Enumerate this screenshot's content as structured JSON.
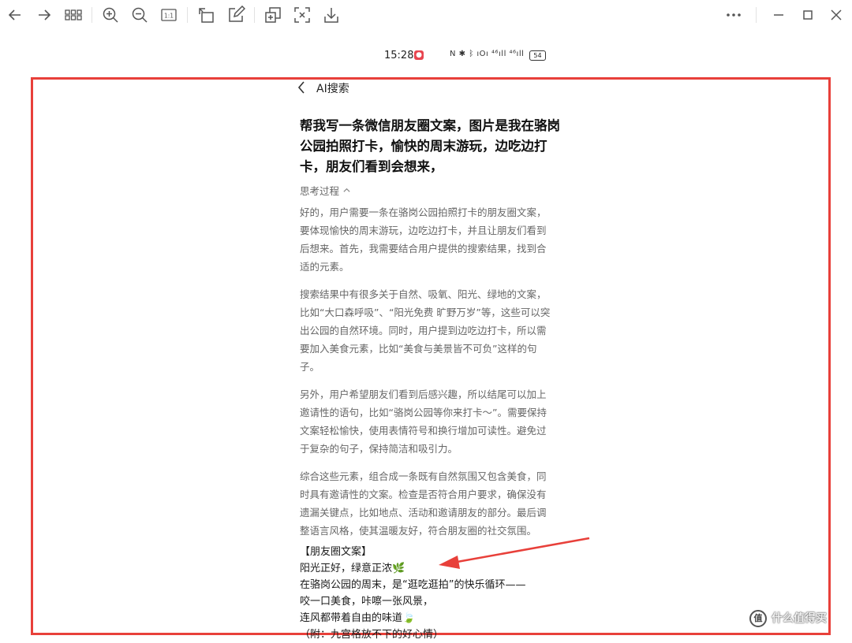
{
  "toolbar": {
    "buttons": [
      {
        "icon": "back-arrow-icon"
      },
      {
        "icon": "forward-arrow-icon"
      },
      {
        "icon": "grid-view-icon"
      },
      {
        "icon": "zoom-in-icon"
      },
      {
        "icon": "zoom-out-icon"
      },
      {
        "icon": "actual-size-icon",
        "label": "1:1"
      },
      {
        "icon": "rotate-icon"
      },
      {
        "icon": "edit-icon"
      },
      {
        "icon": "copy-icon"
      },
      {
        "icon": "screen-capture-icon"
      },
      {
        "icon": "download-icon"
      },
      {
        "icon": "more-icon"
      },
      {
        "icon": "minimize-icon"
      },
      {
        "icon": "maximize-icon"
      },
      {
        "icon": "close-icon"
      }
    ]
  },
  "status_bar": {
    "time": "15:28",
    "badge": "●",
    "icons": "N ✱ ᛒ ıOı ⁴⁶ıll ⁴⁶ıll",
    "battery": "54"
  },
  "nav": {
    "title": "AI搜索"
  },
  "query": "帮我写一条微信朋友圈文案，图片是我在骆岗公园拍照打卡，愉快的周末游玩，边吃边打卡，朋友们看到会想来，",
  "thinking": {
    "label": "思考过程",
    "paragraphs": [
      "好的，用户需要一条在骆岗公园拍照打卡的朋友圈文案，要体现愉快的周末游玩，边吃边打卡，并且让朋友们看到后想来。首先，我需要结合用户提供的搜索结果，找到合适的元素。",
      "搜索结果中有很多关于自然、吸氧、阳光、绿地的文案，比如“大口森呼吸”、“阳光免费 旷野万岁”等，这些可以突出公园的自然环境。同时，用户提到边吃边打卡，所以需要加入美食元素，比如“美食与美景皆不可负”这样的句子。",
      "另外，用户希望朋友们看到后感兴趣，所以结尾可以加上邀请性的语句，比如“骆岗公园等你来打卡～”。需要保持文案轻松愉快，使用表情符号和换行增加可读性。避免过于复杂的句子，保持简洁和吸引力。",
      "综合这些元素，组合成一条既有自然氛围又包含美食，同时具有邀请性的文案。检查是否符合用户要求，确保没有遗漏关键点，比如地点、活动和邀请朋友的部分。最后调整语言风格，使其温暖友好，符合朋友圈的社交氛围。"
    ]
  },
  "answer": {
    "lines": [
      "【朋友圈文案】",
      "阳光正好，绿意正浓🌿",
      "在骆岗公园的周末，是“逛吃逛拍”的快乐循环——",
      "咬一口美食，咔嚓一张风景，",
      "连风都带着自由的味道🍃",
      "（附：九宫格放不下的好心情）"
    ]
  },
  "watermark": {
    "text": "什么值得买",
    "logo": "值"
  },
  "colors": {
    "highlight_frame": "#e8403a",
    "arrow": "#e8403a",
    "reasoning_text": "#666666",
    "toolbar_icon": "#555555"
  }
}
